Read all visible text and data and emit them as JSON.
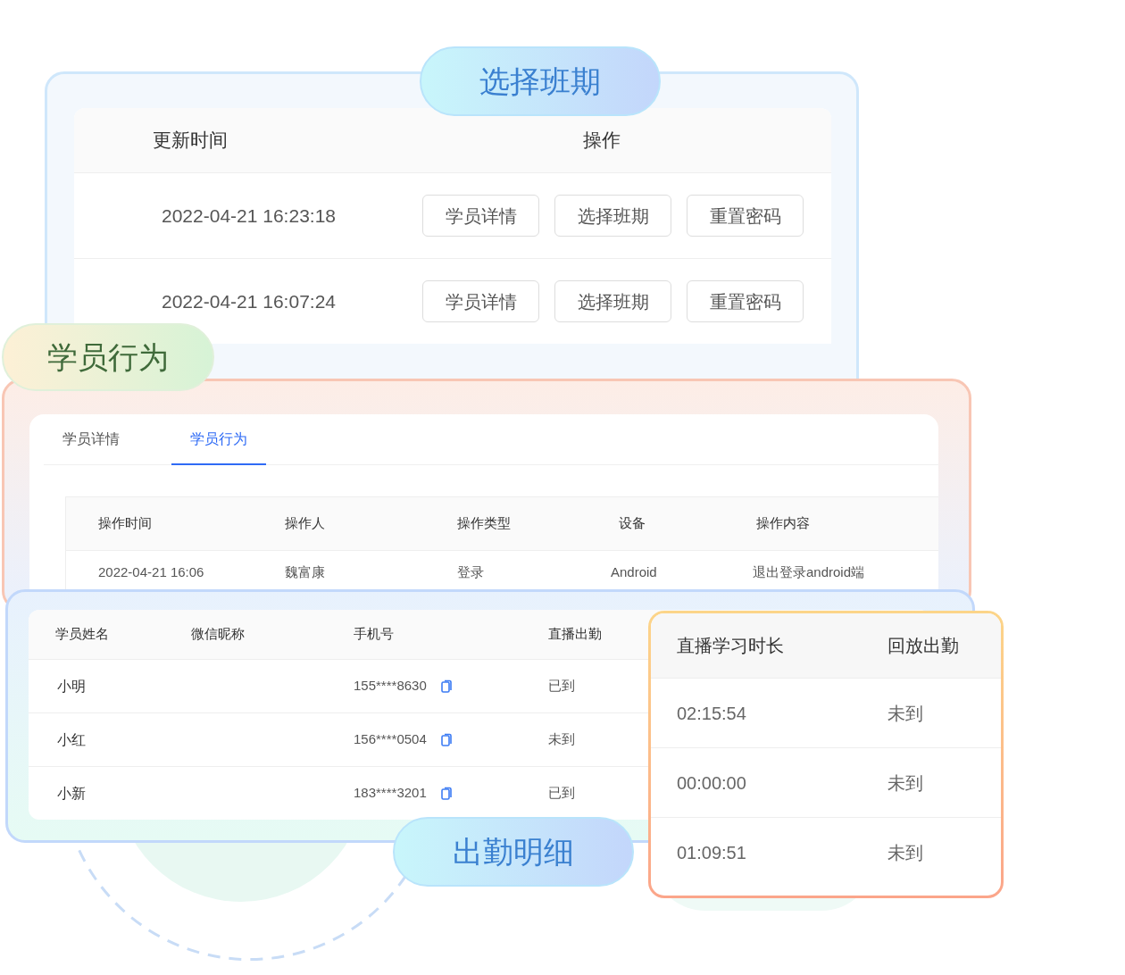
{
  "class_picker": {
    "badge": "选择班期",
    "columns": [
      "更新时间",
      "操作"
    ],
    "rows": [
      {
        "time": "2022-04-21 16:23:18",
        "actions": [
          "学员详情",
          "选择班期",
          "重置密码"
        ]
      },
      {
        "time": "2022-04-21 16:07:24",
        "actions": [
          "学员详情",
          "选择班期",
          "重置密码"
        ]
      }
    ]
  },
  "behavior": {
    "badge": "学员行为",
    "tabs": [
      {
        "label": "学员详情",
        "selected": false
      },
      {
        "label": "学员行为",
        "selected": true
      }
    ],
    "columns": [
      "操作时间",
      "操作人",
      "操作类型",
      "设备",
      "操作内容"
    ],
    "rows": [
      {
        "cells": [
          "2022-04-21 16:06",
          "魏富康",
          "登录",
          "Android",
          "退出登录android端"
        ]
      }
    ]
  },
  "attendance": {
    "badge": "出勤明细",
    "columns": [
      "学员姓名",
      "微信昵称",
      "手机号",
      "直播出勤"
    ],
    "rows": [
      {
        "name": "小明",
        "phone": "155****8630",
        "live": "已到"
      },
      {
        "name": "小红",
        "phone": "156****0504",
        "live": "未到"
      },
      {
        "name": "小新",
        "phone": "183****3201",
        "live": "已到"
      }
    ],
    "detail": {
      "columns": [
        "直播学习时长",
        "回放出勤"
      ],
      "rows": [
        {
          "duration": "02:15:54",
          "replay": "未到"
        },
        {
          "duration": "00:00:00",
          "replay": "未到"
        },
        {
          "duration": "01:09:51",
          "replay": "未到"
        }
      ]
    }
  }
}
